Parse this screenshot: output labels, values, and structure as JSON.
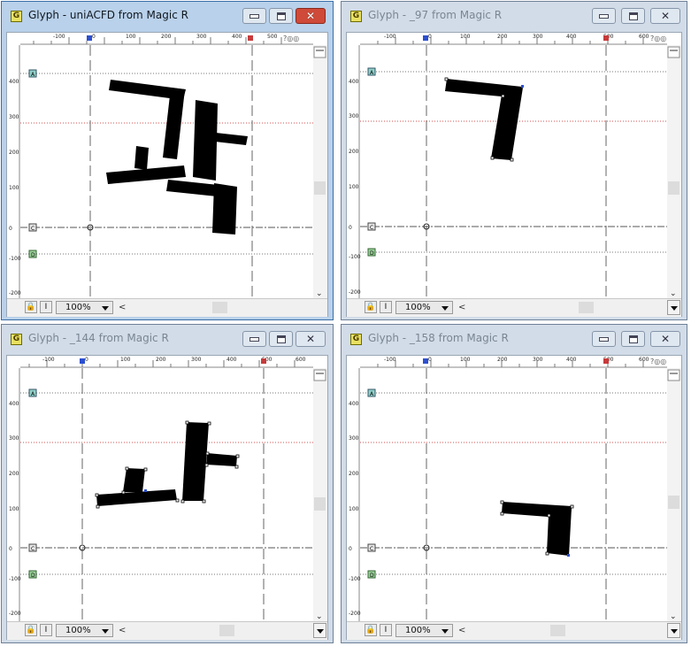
{
  "windows": [
    {
      "id": "tl",
      "title": "Glyph - uniACFD from Magic R",
      "active": true,
      "zoom": "100%",
      "hruler_labels": [
        "-100",
        "0",
        "100",
        "200",
        "300",
        "400",
        "500"
      ],
      "vruler_labels": [
        "400",
        "300",
        "200",
        "100",
        "0",
        "-100",
        "-200"
      ],
      "guide_badges": [
        "A",
        "C",
        "D"
      ],
      "ruler_buttons": "?◎◎"
    },
    {
      "id": "tr",
      "title": "Glyph - _97 from Magic R",
      "active": false,
      "zoom": "100%",
      "hruler_labels": [
        "-100",
        "0",
        "100",
        "200",
        "300",
        "400",
        "500",
        "600"
      ],
      "vruler_labels": [
        "400",
        "300",
        "200",
        "100",
        "0",
        "-100",
        "-200"
      ],
      "guide_badges": [
        "A",
        "C",
        "D"
      ],
      "ruler_buttons": "?◎◎"
    },
    {
      "id": "bl",
      "title": "Glyph - _144 from Magic R",
      "active": false,
      "zoom": "100%",
      "hruler_labels": [
        "-100",
        "0",
        "100",
        "200",
        "300",
        "400",
        "500",
        "600"
      ],
      "vruler_labels": [
        "400",
        "300",
        "200",
        "100",
        "0",
        "-100",
        "-200"
      ],
      "guide_badges": [
        "A",
        "C",
        "D"
      ],
      "ruler_buttons": "?◎◎"
    },
    {
      "id": "br",
      "title": "Glyph - _158 from Magic R",
      "active": false,
      "zoom": "100%",
      "hruler_labels": [
        "-100",
        "0",
        "100",
        "200",
        "300",
        "400",
        "500",
        "600"
      ],
      "vruler_labels": [
        "400",
        "300",
        "200",
        "100",
        "0",
        "-100",
        "-200"
      ],
      "guide_badges": [
        "A",
        "C",
        "D"
      ],
      "ruler_buttons": "?◎◎"
    }
  ],
  "statusbar": {
    "lock_icon": "lock-icon",
    "cursor_label": "I"
  },
  "colors": {
    "active_title": "#b9d1ea",
    "inactive_title": "#d2dce8",
    "close_active": "#cf4a38",
    "ascender_line": "#d05050",
    "guide_line": "#6a6a6a"
  }
}
